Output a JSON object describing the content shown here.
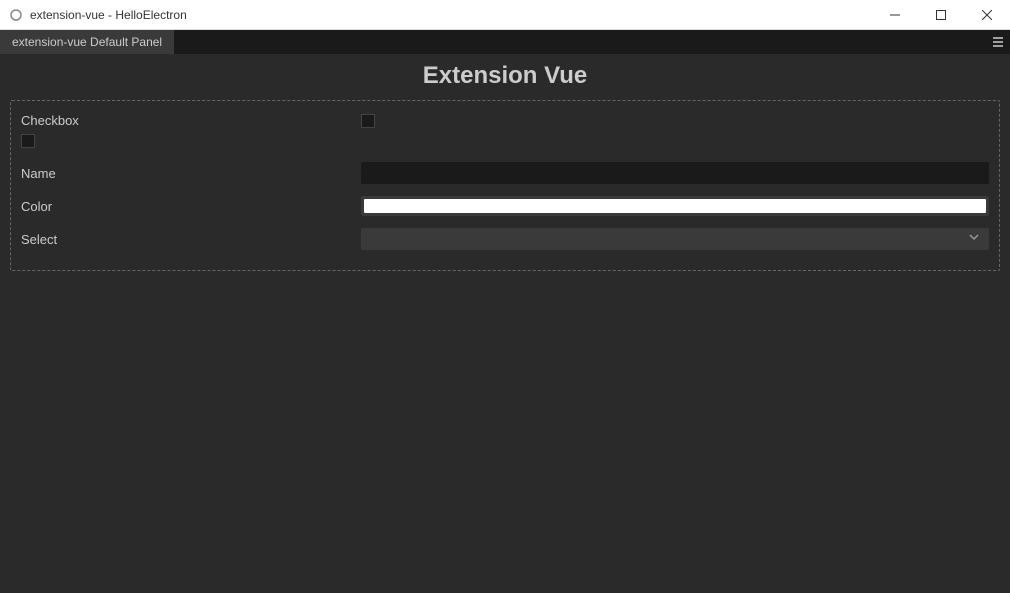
{
  "window": {
    "title": "extension-vue - HelloElectron"
  },
  "tabbar": {
    "active_tab": "extension-vue Default Panel"
  },
  "page": {
    "title": "Extension Vue"
  },
  "form": {
    "checkbox": {
      "label": "Checkbox",
      "checked": false
    },
    "name": {
      "label": "Name",
      "value": ""
    },
    "color": {
      "label": "Color",
      "value": "#ffffff"
    },
    "select": {
      "label": "Select",
      "value": ""
    }
  }
}
